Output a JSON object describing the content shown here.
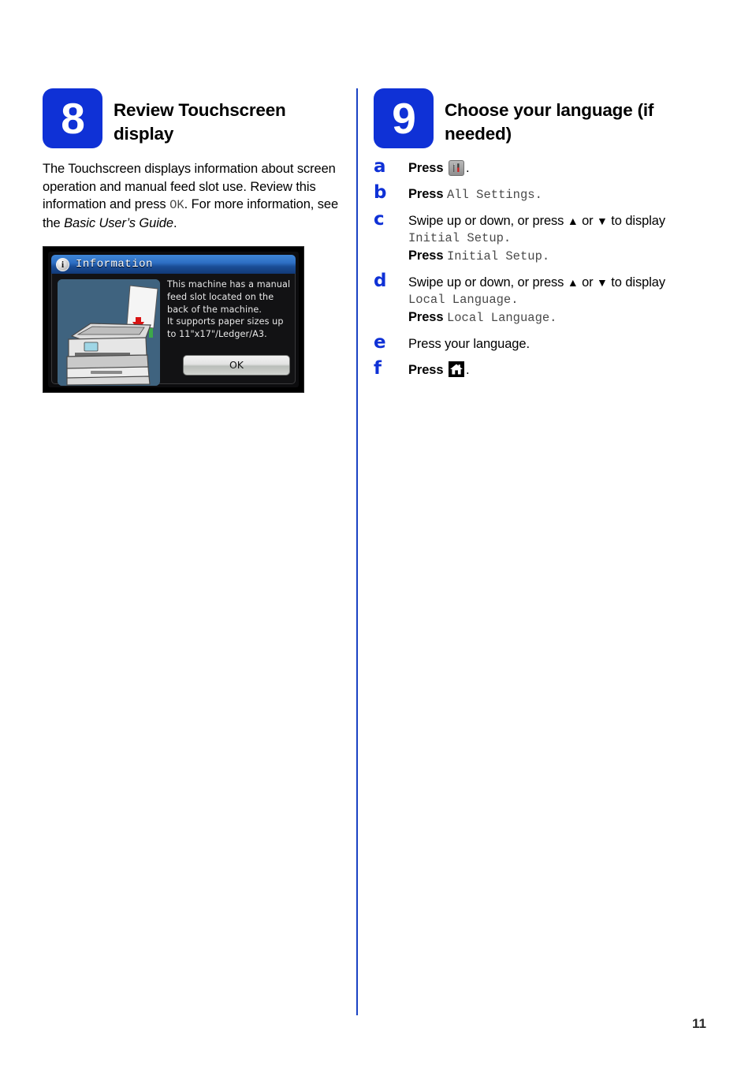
{
  "page": {
    "number": "11"
  },
  "step8": {
    "badge": "8",
    "title": "Review Touchscreen display",
    "body_part1": "The Touchscreen displays information about screen operation and manual feed slot use. Review this information and press ",
    "body_ok": "OK",
    "body_part2": ". For more information, see the ",
    "body_guide": "Basic User’s Guide",
    "body_part3": ".",
    "touchscreen": {
      "info_icon": "info-icon",
      "title": "Information",
      "message": "This machine has a manual feed slot located on the back of the machine.\nIt supports paper sizes up to 11\"x17\"/Ledger/A3.",
      "ok_label": "OK",
      "illustration": "printer-manual-feed-illustration"
    }
  },
  "step9": {
    "badge": "9",
    "title": "Choose your language (if needed)",
    "substeps": [
      {
        "letter": "a",
        "press_label": "Press",
        "icon": "settings-icon",
        "trailing": "."
      },
      {
        "letter": "b",
        "press_label": "Press",
        "mono_value": "All Settings."
      },
      {
        "letter": "c",
        "line1_pre": "Swipe up or down, or press ",
        "up_arrow": "▲",
        "line1_mid": " or ",
        "down_arrow": "▼",
        "line1_post": " to display",
        "line2_mono": "Initial Setup.",
        "press_label": "Press",
        "line3_mono": "Initial Setup."
      },
      {
        "letter": "d",
        "line1_pre": "Swipe up or down, or press ",
        "up_arrow": "▲",
        "line1_mid": " or ",
        "down_arrow": "▼",
        "line1_post": " to display",
        "line2_mono": "Local Language.",
        "press_label": "Press",
        "line3_mono": "Local Language."
      },
      {
        "letter": "e",
        "text": "Press your language."
      },
      {
        "letter": "f",
        "press_label": "Press",
        "icon": "home-icon",
        "trailing": "."
      }
    ]
  },
  "colors": {
    "accent_blue": "#0f31d6",
    "divider_blue": "#1b43c4",
    "mono_gray": "#4a4a4a",
    "screen_bg": "#3f637f"
  }
}
